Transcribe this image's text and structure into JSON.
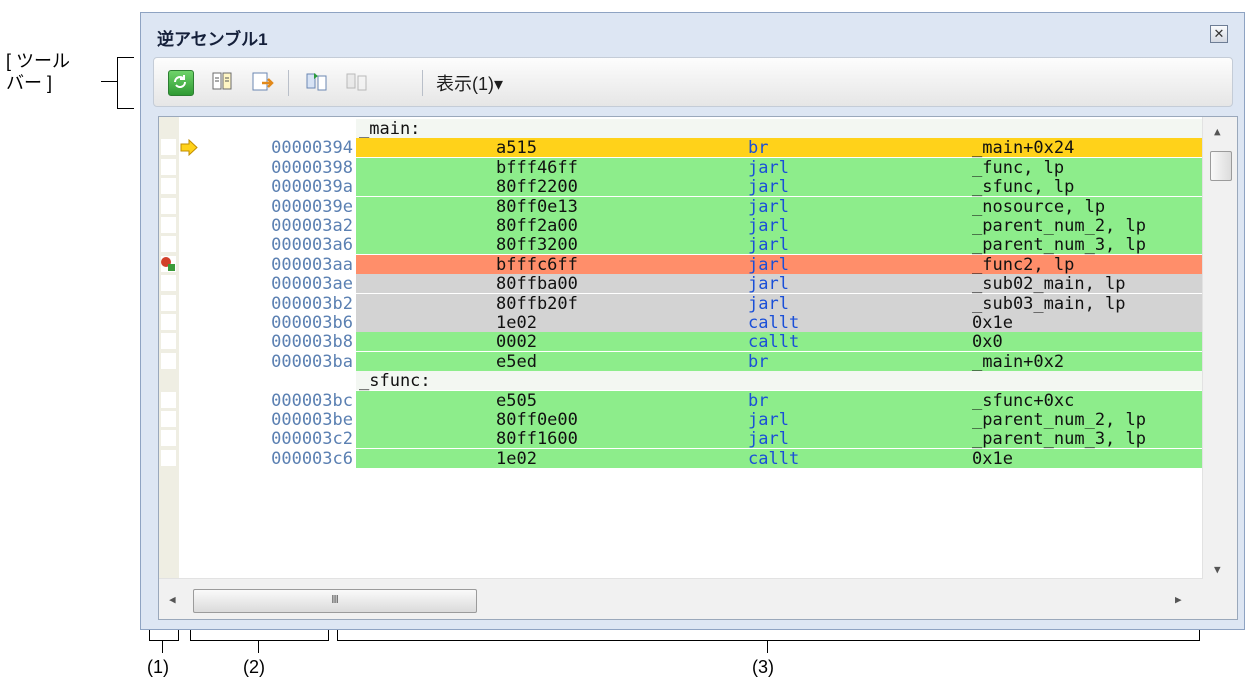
{
  "callouts": {
    "toolbar_label_line1": "[ ツール",
    "toolbar_label_line2": "バー ]",
    "area1": "(1)",
    "area2": "(2)",
    "area3": "(3)"
  },
  "window": {
    "title": "逆アセンブル1",
    "close_symbol": "✕"
  },
  "toolbar": {
    "buttons": [
      "refresh-icon",
      "disasm-jump-icon",
      "export-icon",
      "step-in-icon",
      "step-out-icon"
    ],
    "view_menu_label": "表示(1)▾"
  },
  "colors": {
    "green": "#8ded8b",
    "gray": "#d3d3d3",
    "pc": "#ffd21a",
    "breakpoint": "#ff8e6a",
    "label_bg": "#f3f7f2",
    "mnemonic": "#1a4fd8",
    "address": "#5b80b2"
  },
  "scrollbar": {
    "h_thumb_glyph": "Ⅲ",
    "up": "▲",
    "down": "▼",
    "left": "◀",
    "right": "▶"
  },
  "rows": [
    {
      "label": "_main:"
    },
    {
      "address": "00000394",
      "opcode": "a515",
      "mnemonic": "br",
      "operand": "_main+0x24",
      "color": "pc",
      "marker": "pc-arrow"
    },
    {
      "address": "00000398",
      "opcode": "bfff46ff",
      "mnemonic": "jarl",
      "operand": "_func, lp",
      "color": "green"
    },
    {
      "address": "0000039a",
      "opcode": "80ff2200",
      "mnemonic": "jarl",
      "operand": "_sfunc, lp",
      "color": "green"
    },
    {
      "address": "0000039e",
      "opcode": "80ff0e13",
      "mnemonic": "jarl",
      "operand": "_nosource, lp",
      "color": "green"
    },
    {
      "address": "000003a2",
      "opcode": "80ff2a00",
      "mnemonic": "jarl",
      "operand": "_parent_num_2, lp",
      "color": "green"
    },
    {
      "address": "000003a6",
      "opcode": "80ff3200",
      "mnemonic": "jarl",
      "operand": "_parent_num_3, lp",
      "color": "green"
    },
    {
      "address": "000003aa",
      "opcode": "bfffc6ff",
      "mnemonic": "jarl",
      "operand": "_func2, lp",
      "color": "breakpoint",
      "marker": "breakpoint-icon"
    },
    {
      "address": "000003ae",
      "opcode": "80ffba00",
      "mnemonic": "jarl",
      "operand": "_sub02_main, lp",
      "color": "gray"
    },
    {
      "address": "000003b2",
      "opcode": "80ffb20f",
      "mnemonic": "jarl",
      "operand": "_sub03_main, lp",
      "color": "gray"
    },
    {
      "address": "000003b6",
      "opcode": "1e02",
      "mnemonic": "callt",
      "operand": "0x1e",
      "color": "gray"
    },
    {
      "address": "000003b8",
      "opcode": "0002",
      "mnemonic": "callt",
      "operand": "0x0",
      "color": "green"
    },
    {
      "address": "000003ba",
      "opcode": "e5ed",
      "mnemonic": "br",
      "operand": "_main+0x2",
      "color": "green"
    },
    {
      "label": "_sfunc:"
    },
    {
      "address": "000003bc",
      "opcode": "e505",
      "mnemonic": "br",
      "operand": "_sfunc+0xc",
      "color": "green"
    },
    {
      "address": "000003be",
      "opcode": "80ff0e00",
      "mnemonic": "jarl",
      "operand": "_parent_num_2, lp",
      "color": "green"
    },
    {
      "address": "000003c2",
      "opcode": "80ff1600",
      "mnemonic": "jarl",
      "operand": "_parent_num_3, lp",
      "color": "green"
    },
    {
      "address": "000003c6",
      "opcode": "1e02",
      "mnemonic": "callt",
      "operand": "0x1e",
      "color": "green"
    }
  ]
}
